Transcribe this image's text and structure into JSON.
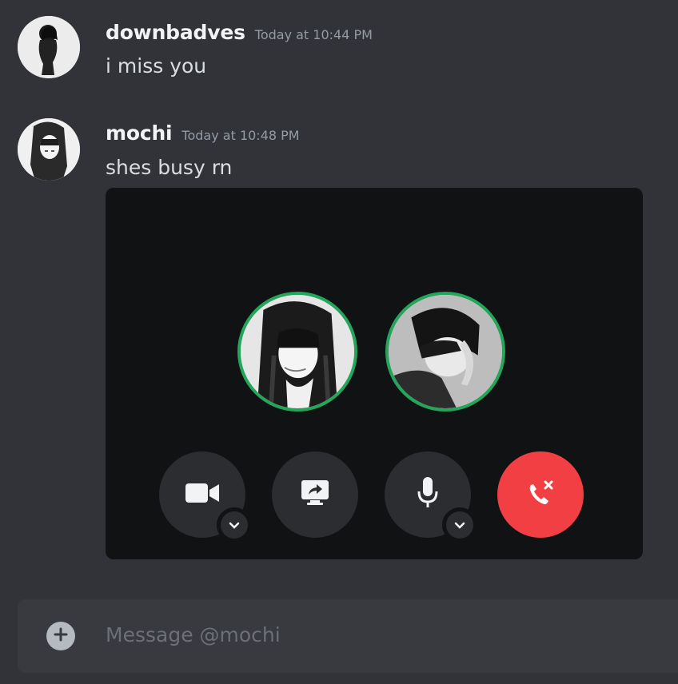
{
  "messages": [
    {
      "username": "downbadves",
      "timestamp": "Today at 10:44 PM",
      "text": "i miss you"
    },
    {
      "username": "mochi",
      "timestamp": "Today at 10:48 PM",
      "text": "shes busy rn"
    }
  ],
  "call": {
    "participants": [
      "participant-avatar-girl",
      "participant-avatar-boy"
    ],
    "controls": [
      "camera-button",
      "screen-share-button",
      "microphone-button",
      "end-call-button"
    ]
  },
  "composer": {
    "placeholder": "Message @mochi"
  },
  "colors": {
    "background": "#313338",
    "call_background": "#111214",
    "speaking_ring": "#23a55a",
    "end_call": "#f23f43"
  }
}
